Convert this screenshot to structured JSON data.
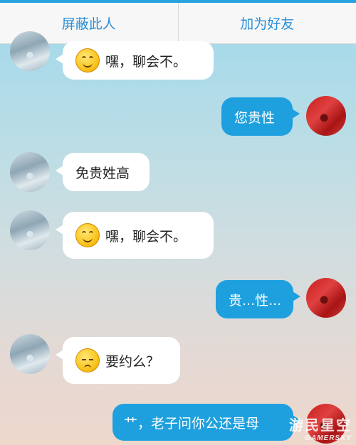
{
  "header": {
    "block_label": "屏蔽此人",
    "add_friend_label": "加为好友"
  },
  "messages": [
    {
      "side": "incoming",
      "emoji": "smile-emoji",
      "text": "嘿，聊会不。"
    },
    {
      "side": "outgoing",
      "text": "您贵性"
    },
    {
      "side": "incoming",
      "text": "免贵姓高"
    },
    {
      "side": "incoming",
      "emoji": "smile-emoji",
      "text": "嘿，聊会不。"
    },
    {
      "side": "outgoing",
      "text": "贵...性..."
    },
    {
      "side": "incoming",
      "emoji": "smirk-emoji",
      "text": "要约么？"
    },
    {
      "side": "outgoing",
      "text": "艹，老子问你公还是母"
    }
  ],
  "watermark": {
    "brand_cn": "游民星空",
    "brand_en": "GAMERSKY"
  },
  "colors": {
    "accent": "#27a3e0",
    "outgoing_bubble": "#1ea0de",
    "incoming_bubble": "#ffffff"
  }
}
